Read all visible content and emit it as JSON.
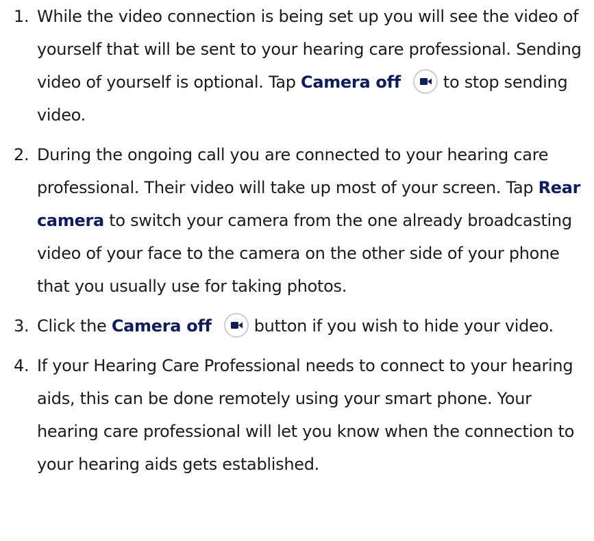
{
  "steps": [
    {
      "number": "1.",
      "text_before": "While the video connection is being set up you will see the video of yourself that will be sent to your hearing care professional. Sending video of yourself is optional. Tap ",
      "highlight": "Camera off",
      "text_after": "to stop sending video."
    },
    {
      "number": "2.",
      "text_before": "During the ongoing call you are connected to your hearing care professional. Their video will take up most of your screen. Tap ",
      "highlight": "Rear camera",
      "text_after": " to switch your camera from the one already broadcasting video of your face to the camera on the other side of your phone that you usually use for taking photos."
    },
    {
      "number": "3.",
      "text_before": "Click the ",
      "highlight": "Camera off",
      "text_after": "button if you wish to hide your video."
    },
    {
      "number": "4.",
      "text": "If your Hearing Care Professional needs to connect to your hearing aids, this can be done remotely using your smart phone. Your hearing care professional will let you know when the connection to your hearing aids gets established."
    }
  ],
  "icons": {
    "camera_button": "video-camera-icon"
  },
  "colors": {
    "text": "#1b1b1f",
    "highlight": "#0d1d5e",
    "icon_border": "#c9ccd6"
  }
}
